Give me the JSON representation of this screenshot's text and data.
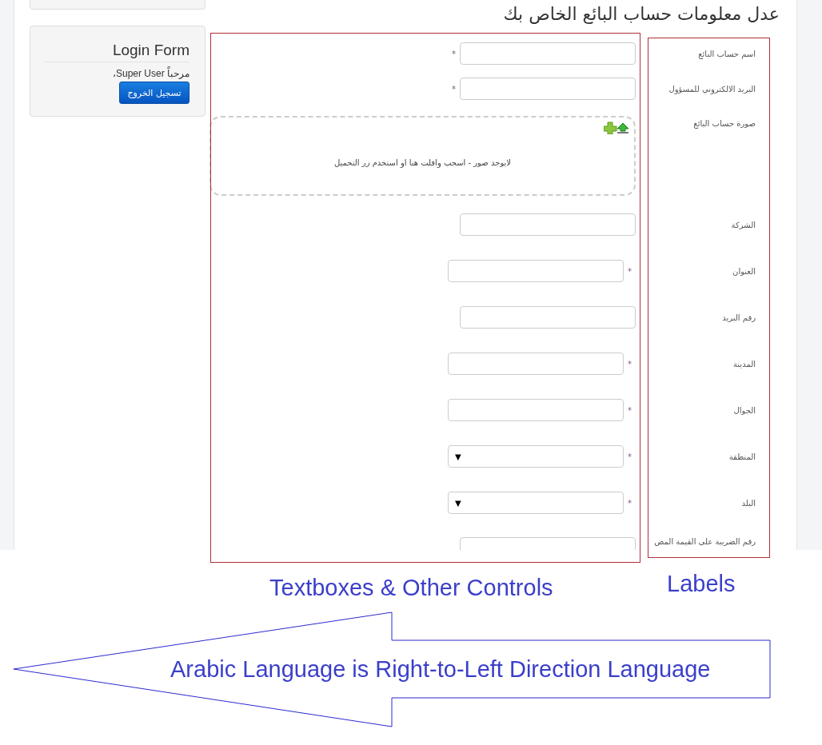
{
  "page_title": "عدل معلومات حساب البائع الخاص بك",
  "login_form": {
    "title": "Login Form",
    "greeting": "مرحباً Super User،",
    "logout_button": "تسجيل الخروج"
  },
  "fields": [
    {
      "kind": "text",
      "label": "اسم حساب البائع",
      "asterisk": "*",
      "asterisk_first": false
    },
    {
      "kind": "text",
      "label": "البريد الالكتروني للمسؤول",
      "asterisk": "*",
      "asterisk_first": false
    },
    {
      "kind": "dropzone",
      "label": "صورة حساب البائع",
      "message": "لايوجد صور - اسحب وافلت هنا او استخدم زر التحميل"
    },
    {
      "kind": "text",
      "label": "الشركة"
    },
    {
      "kind": "text",
      "label": "العنوان",
      "asterisk": "*",
      "asterisk_first": true
    },
    {
      "kind": "text",
      "label": "رقم البريد"
    },
    {
      "kind": "text",
      "label": "المدينة",
      "asterisk": "*",
      "asterisk_first": true
    },
    {
      "kind": "text",
      "label": "الجوال",
      "asterisk": "*",
      "asterisk_first": true
    },
    {
      "kind": "select",
      "label": "المنطقة",
      "arrow": "▼",
      "asterisk": "*",
      "asterisk_first": true
    },
    {
      "kind": "select",
      "label": "البلد",
      "arrow": "▼",
      "asterisk": "*",
      "asterisk_first": true
    },
    {
      "kind": "text",
      "label": "رقم الضريبة على القيمة المض"
    }
  ],
  "annotations": {
    "controls_caption": "Textboxes & Other Controls",
    "labels_caption": "Labels",
    "arrow_text": "Arabic Language is Right-to-Left Direction Language"
  }
}
